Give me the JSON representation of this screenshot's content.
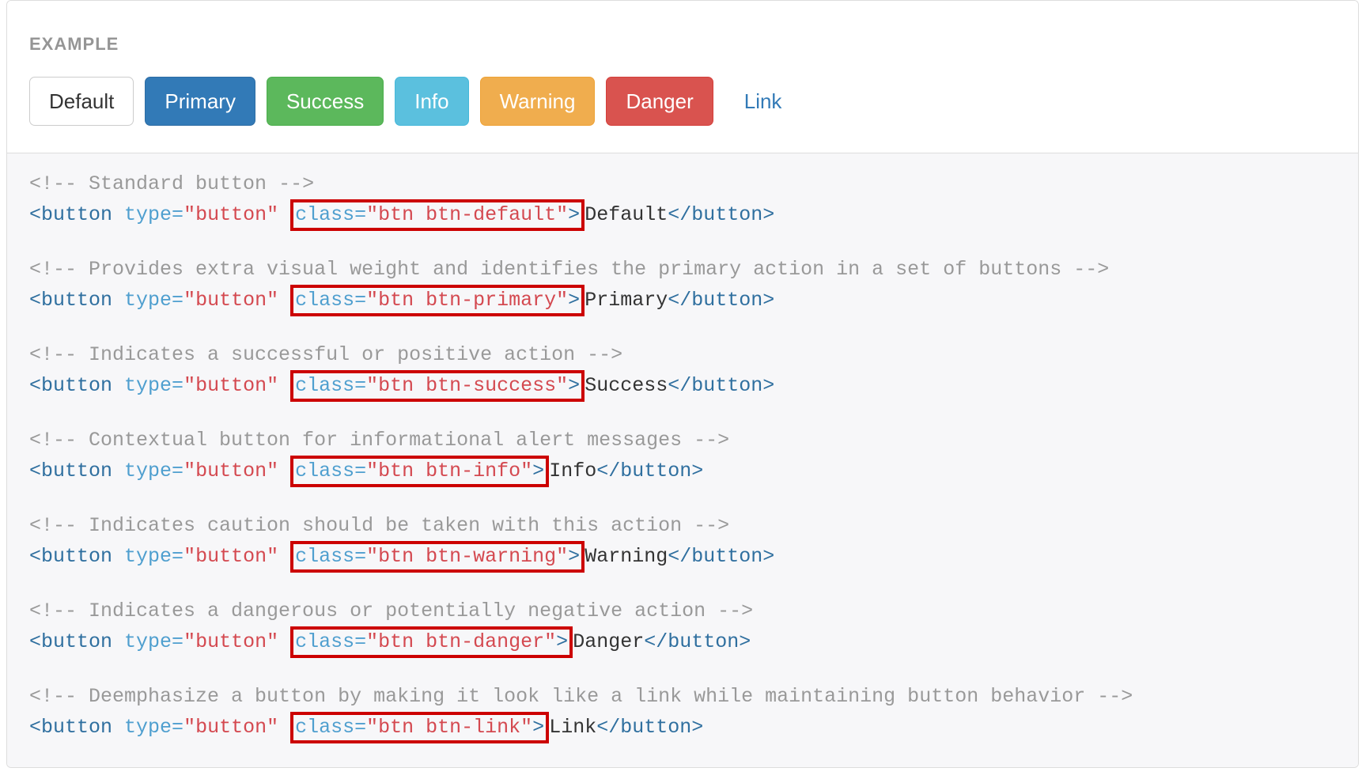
{
  "header": {
    "label": "EXAMPLE"
  },
  "buttons": {
    "default": "Default",
    "primary": "Primary",
    "success": "Success",
    "info": "Info",
    "warning": "Warning",
    "danger": "Danger",
    "link": "Link"
  },
  "code": {
    "open_comment": "<!--",
    "close_comment": "-->",
    "open_tag1": "<button",
    "attr_type_key": "type=",
    "attr_type_val": "\"button\"",
    "attr_class_key": "class=",
    "tag_close_gt": ">",
    "close_tag": "</button>",
    "groups": [
      {
        "comment": " Standard button ",
        "class_val": "\"btn btn-default\"",
        "text": "Default"
      },
      {
        "comment": " Provides extra visual weight and identifies the primary action in a set of buttons ",
        "class_val": "\"btn btn-primary\"",
        "text": "Primary"
      },
      {
        "comment": " Indicates a successful or positive action ",
        "class_val": "\"btn btn-success\"",
        "text": "Success"
      },
      {
        "comment": " Contextual button for informational alert messages ",
        "class_val": "\"btn btn-info\"",
        "text": "Info"
      },
      {
        "comment": " Indicates caution should be taken with this action ",
        "class_val": "\"btn btn-warning\"",
        "text": "Warning"
      },
      {
        "comment": " Indicates a dangerous or potentially negative action ",
        "class_val": "\"btn btn-danger\"",
        "text": "Danger"
      },
      {
        "comment": " Deemphasize a button by making it look like a link while maintaining button behavior ",
        "class_val": "\"btn btn-link\"",
        "text": "Link"
      }
    ]
  }
}
